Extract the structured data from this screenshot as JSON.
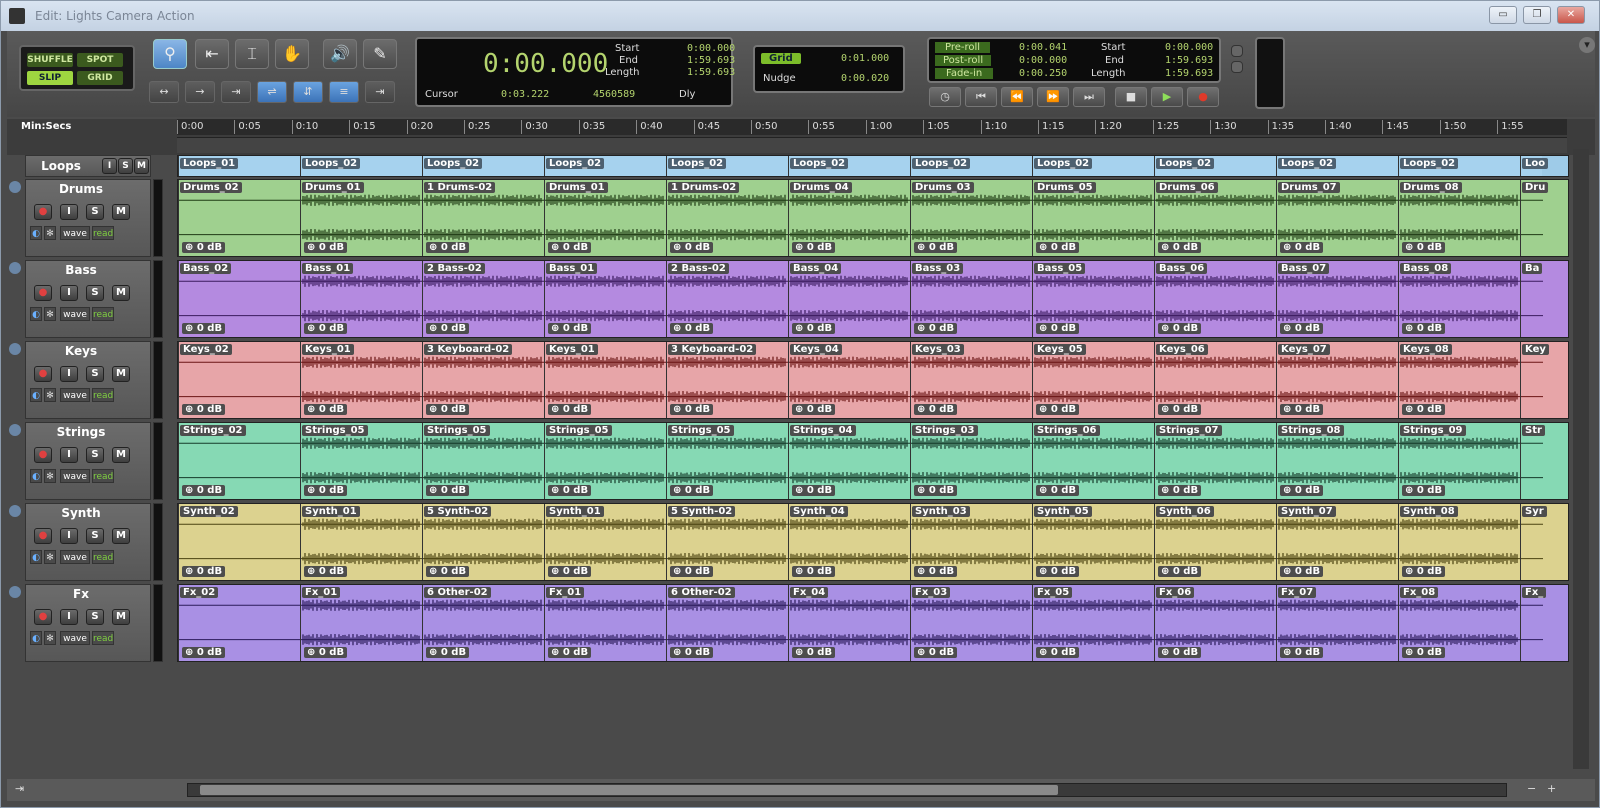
{
  "window": {
    "title": "Edit: Lights Camera Action"
  },
  "modes": {
    "shuffle": "SHUFFLE",
    "spot": "SPOT",
    "slip": "SLIP",
    "grid": "GRID"
  },
  "counter": {
    "main": "0:00.000",
    "start_label": "Start",
    "end_label": "End",
    "length_label": "Length",
    "start": "0:00.000",
    "end": "1:59.693",
    "length": "1:59.693",
    "cursor_label": "Cursor",
    "cursor": "0:03.222",
    "samples": "4560589",
    "dly": "Dly"
  },
  "grid": {
    "grid_label": "Grid",
    "grid_value": "0:01.000",
    "nudge_label": "Nudge",
    "nudge_value": "0:00.020"
  },
  "transport": {
    "preroll_label": "Pre-roll",
    "postroll_label": "Post-roll",
    "fadein_label": "Fade-in",
    "preroll": "0:00.041",
    "postroll": "0:00.000",
    "fadein": "0:00.250",
    "start_label": "Start",
    "end_label": "End",
    "length_label": "Length",
    "start": "0:00.000",
    "end": "1:59.693",
    "length": "1:59.693"
  },
  "ruler": {
    "format": "Min:Secs",
    "ticks": [
      "0:00",
      "0:05",
      "0:10",
      "0:15",
      "0:20",
      "0:25",
      "0:30",
      "0:35",
      "0:40",
      "0:45",
      "0:50",
      "0:55",
      "1:00",
      "1:05",
      "1:10",
      "1:15",
      "1:20",
      "1:25",
      "1:30",
      "1:35",
      "1:40",
      "1:45",
      "1:50",
      "1:55"
    ]
  },
  "loops": {
    "name": "Loops",
    "i": "I",
    "s": "S",
    "m": "M",
    "clips": [
      "Loops_01",
      "Loops_02",
      "Loops_02",
      "Loops_02",
      "Loops_02",
      "Loops_02",
      "Loops_02",
      "Loops_02",
      "Loops_02",
      "Loops_02",
      "Loops_02",
      "Loo"
    ]
  },
  "tracks": [
    {
      "name": "Drums",
      "color": "#9fd08f",
      "wave": "#1f3a14",
      "clips": [
        "Drums_02",
        "Drums_01",
        "1 Drums-02",
        "Drums_01",
        "1 Drums-02",
        "Drums_04",
        "Drums_03",
        "Drums_05",
        "Drums_06",
        "Drums_07",
        "Drums_08",
        "Dru"
      ]
    },
    {
      "name": "Bass",
      "color": "#b48ae0",
      "wave": "#3a1a5e",
      "clips": [
        "Bass_02",
        "Bass_01",
        "2 Bass-02",
        "Bass_01",
        "2 Bass-02",
        "Bass_04",
        "Bass_03",
        "Bass_05",
        "Bass_06",
        "Bass_07",
        "Bass_08",
        "Ba"
      ]
    },
    {
      "name": "Keys",
      "color": "#e7a5a8",
      "wave": "#6a1414",
      "clips": [
        "Keys_02",
        "Keys_01",
        "3 Keyboard-02",
        "Keys_01",
        "3 Keyboard-02",
        "Keys_04",
        "Keys_03",
        "Keys_05",
        "Keys_06",
        "Keys_07",
        "Keys_08",
        "Key"
      ]
    },
    {
      "name": "Strings",
      "color": "#86d9b4",
      "wave": "#153a2a",
      "clips": [
        "Strings_02",
        "Strings_05",
        "Strings_05",
        "Strings_05",
        "Strings_05",
        "Strings_04",
        "Strings_03",
        "Strings_06",
        "Strings_07",
        "Strings_08",
        "Strings_09",
        "Str"
      ]
    },
    {
      "name": "Synth",
      "color": "#dcd28f",
      "wave": "#4a4210",
      "clips": [
        "Synth_02",
        "Synth_01",
        "5 Synth-02",
        "Synth_01",
        "5 Synth-02",
        "Synth_04",
        "Synth_03",
        "Synth_05",
        "Synth_06",
        "Synth_07",
        "Synth_08",
        "Syr"
      ]
    },
    {
      "name": "Fx",
      "color": "#a990e4",
      "wave": "#2a1a5a",
      "clips": [
        "Fx_02",
        "Fx_01",
        "6 Other-02",
        "Fx_01",
        "6 Other-02",
        "Fx_04",
        "Fx_03",
        "Fx_05",
        "Fx_06",
        "Fx_07",
        "Fx_08",
        "Fx_"
      ]
    }
  ],
  "track_controls": {
    "i": "I",
    "s": "S",
    "m": "M",
    "wave": "wave",
    "read": "read",
    "gain": "0 dB"
  }
}
